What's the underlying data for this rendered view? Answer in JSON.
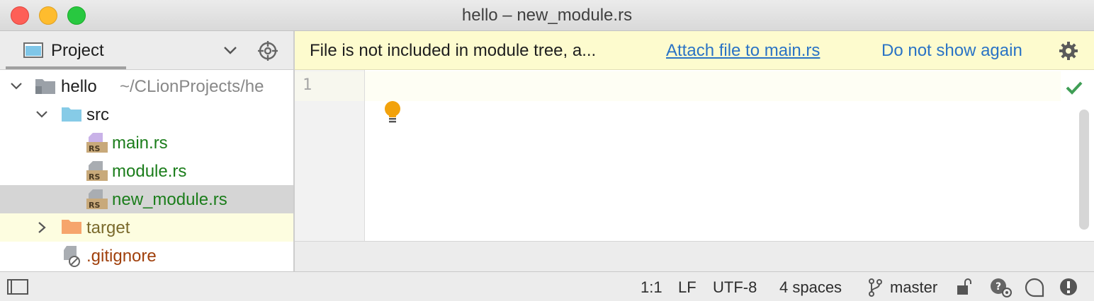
{
  "window": {
    "title": "hello – new_module.rs"
  },
  "project_panel": {
    "title": "Project",
    "tree": [
      {
        "label": "hello",
        "path": "~/CLionProjects/he"
      },
      {
        "label": "src"
      },
      {
        "label": "main.rs",
        "badge": "RS"
      },
      {
        "label": "module.rs",
        "badge": "RS"
      },
      {
        "label": "new_module.rs",
        "badge": "RS"
      },
      {
        "label": "target"
      },
      {
        "label": ".gitignore"
      }
    ]
  },
  "banner": {
    "message": "File is not included in module tree, a...",
    "attach_link": "Attach file to main.rs",
    "dismiss_link": "Do not show again"
  },
  "editor": {
    "line_numbers": [
      "1"
    ]
  },
  "status_bar": {
    "position": "1:1",
    "line_separator": "LF",
    "encoding": "UTF-8",
    "indent": "4 spaces",
    "branch": "master"
  },
  "colors": {
    "banner_bg": "#fdfbce",
    "link": "#2a73c5",
    "vcs_green": "#1b7d1b",
    "excluded_bg": "#fdfde0",
    "gitignore_brown": "#a0400c"
  }
}
